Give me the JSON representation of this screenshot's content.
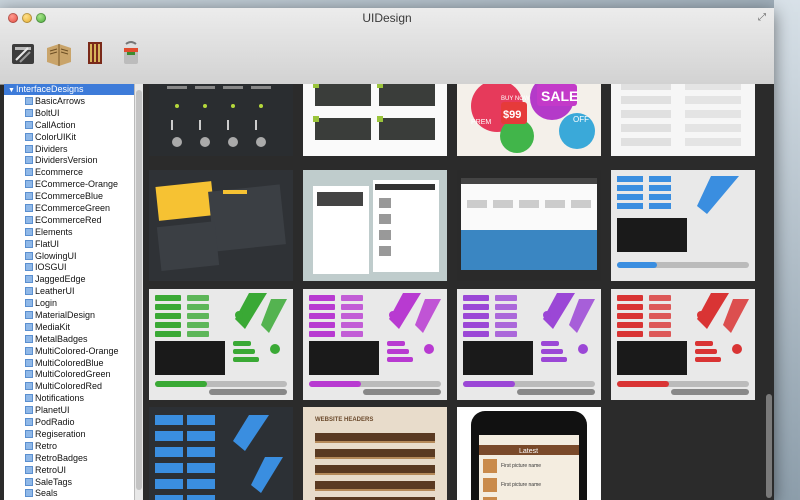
{
  "window": {
    "title": "UIDesign"
  },
  "toolbar": {
    "tools": [
      {
        "icon": "tools-icon"
      },
      {
        "icon": "open-book-icon"
      },
      {
        "icon": "brushes-icon"
      },
      {
        "icon": "paint-bucket-icon"
      }
    ]
  },
  "sidebar": {
    "root": "InterfaceDesigns",
    "items": [
      "BasicArrows",
      "BoltUI",
      "CallAction",
      "ColorUIKit",
      "Dividers",
      "DividersVersion",
      "Ecommerce",
      "ECommerce-Orange",
      "ECommerceBlue",
      "ECommerceGreen",
      "ECommerceRed",
      "Elements",
      "FlatUI",
      "GlowingUI",
      "IOSGUI",
      "JaggedEdge",
      "LeatherUI",
      "Login",
      "MaterialDesign",
      "MediaKit",
      "MetalBadges",
      "MultiColored-Orange",
      "MultiColoredBlue",
      "MultiColoredGreen",
      "MultiColoredRed",
      "Notifications",
      "PlanetUI",
      "PodRadio",
      "Regiseration",
      "Retro",
      "RetroBadges",
      "RetroUI",
      "SaleTags",
      "Seals"
    ]
  },
  "gallery": {
    "thumbnails": [
      {
        "name": "dark-controls",
        "caption": ""
      },
      {
        "name": "grey-banners",
        "caption": ""
      },
      {
        "name": "sale-tags",
        "caption": "SALE",
        "price": "$99",
        "extra": "BUY NOW",
        "off": "OFF",
        "prem": "PREM"
      },
      {
        "name": "light-list",
        "caption": ""
      },
      {
        "name": "dark-dashboard",
        "caption": ""
      },
      {
        "name": "web-layouts",
        "caption": ""
      },
      {
        "name": "web-mockup",
        "caption": ""
      },
      {
        "name": "blue-ui-kit",
        "caption": ""
      },
      {
        "name": "green-ui-kit",
        "caption": ""
      },
      {
        "name": "purple-ui-kit",
        "caption": ""
      },
      {
        "name": "violet-ui-kit",
        "caption": ""
      },
      {
        "name": "red-ui-kit",
        "caption": ""
      },
      {
        "name": "blue-ribbons",
        "caption": ""
      },
      {
        "name": "website-headers",
        "caption": "WEBSITE HEADERS"
      },
      {
        "name": "iphone-app",
        "caption": "Latest",
        "rows": [
          "First picture name",
          "First picture name",
          "First picture name"
        ]
      }
    ]
  },
  "colors": {
    "accent": "#3d7bd9",
    "green": "#3aa935",
    "purple": "#b83ad1",
    "violet": "#9b47d6",
    "red": "#d93434",
    "blue": "#3a8ee0"
  }
}
